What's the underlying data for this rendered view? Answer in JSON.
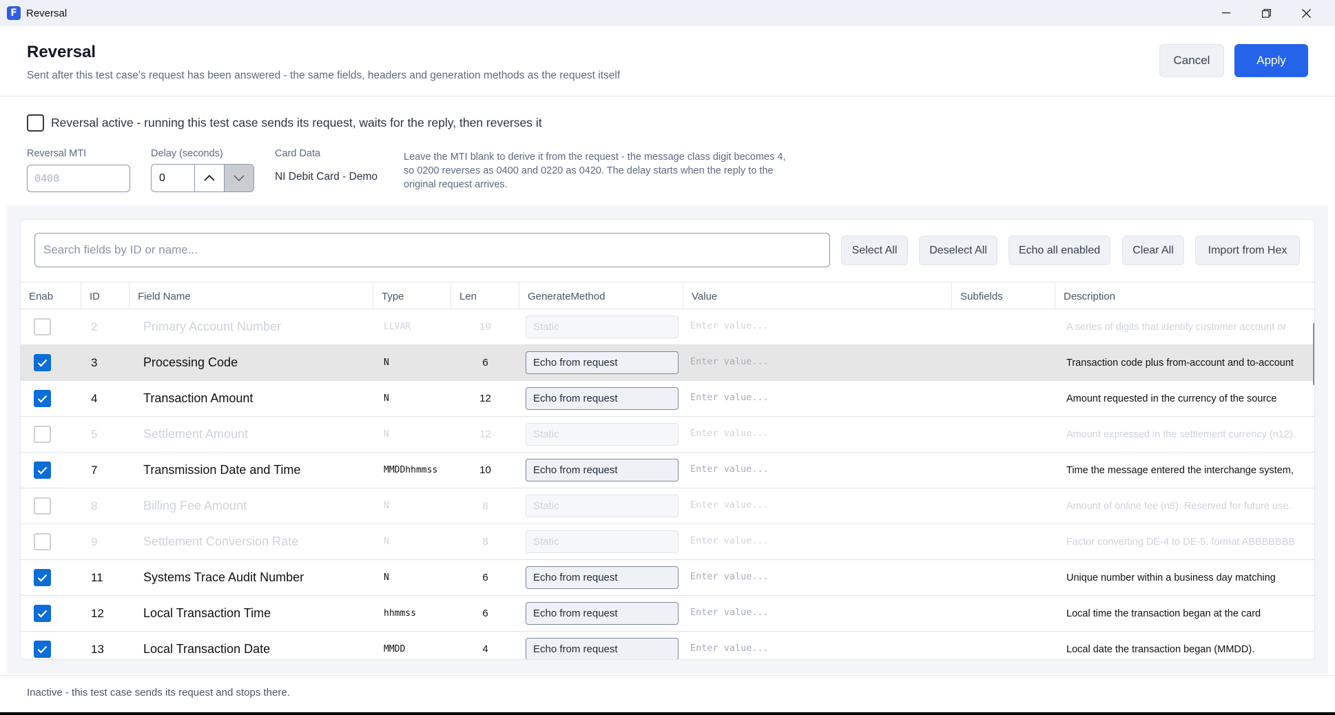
{
  "window": {
    "title": "Reversal",
    "app_icon_letter": "F"
  },
  "header": {
    "title": "Reversal",
    "subtitle": "Sent after this test case's request has been answered - the same fields, headers and generation methods as the request itself",
    "cancel_label": "Cancel",
    "apply_label": "Apply"
  },
  "settings": {
    "active_label": "Reversal active - running this test case sends its request, waits for the reply, then reverses it",
    "active_checked": false,
    "mti_label": "Reversal MTI",
    "mti_placeholder": "0400",
    "delay_label": "Delay (seconds)",
    "delay_value": "0",
    "card_label": "Card Data",
    "card_value": "NI Debit Card - Demo",
    "hint": "Leave the MTI blank to derive it from the request - the message class digit becomes 4, so 0200 reverses as 0400 and 0220 as 0420. The delay starts when the reply to the original request arrives."
  },
  "toolbar": {
    "search_placeholder": "Search fields by ID or name...",
    "select_all": "Select All",
    "deselect_all": "Deselect All",
    "echo_all": "Echo all enabled",
    "clear_all": "Clear All",
    "import_hex": "Import from Hex"
  },
  "table": {
    "columns": [
      "Enab",
      "ID",
      "Field Name",
      "Type",
      "Len",
      "GenerateMethod",
      "Value",
      "Subfields",
      "Description"
    ],
    "value_placeholder": "Enter value...",
    "rows": [
      {
        "enabled": false,
        "selected": false,
        "id": "2",
        "name": "Primary Account Number",
        "type": "LLVAR",
        "len": "19",
        "method": "Static",
        "description": "A series of digits that identify customer account or"
      },
      {
        "enabled": true,
        "selected": true,
        "id": "3",
        "name": "Processing Code",
        "type": "N",
        "len": "6",
        "method": "Echo from request",
        "description": "Transaction code plus from-account and to-account"
      },
      {
        "enabled": true,
        "selected": false,
        "id": "4",
        "name": "Transaction Amount",
        "type": "N",
        "len": "12",
        "method": "Echo from request",
        "description": "Amount requested in the currency of the source"
      },
      {
        "enabled": false,
        "selected": false,
        "id": "5",
        "name": "Settlement Amount",
        "type": "N",
        "len": "12",
        "method": "Static",
        "description": "Amount expressed in the settlement currency (n12)."
      },
      {
        "enabled": true,
        "selected": false,
        "id": "7",
        "name": "Transmission Date and Time",
        "type": "MMDDhhmmss",
        "len": "10",
        "method": "Echo from request",
        "description": "Time the message entered the interchange system,"
      },
      {
        "enabled": false,
        "selected": false,
        "id": "8",
        "name": "Billing Fee Amount",
        "type": "N",
        "len": "8",
        "method": "Static",
        "description": "Amount of online fee (n8). Reserved for future use."
      },
      {
        "enabled": false,
        "selected": false,
        "id": "9",
        "name": "Settlement Conversion Rate",
        "type": "N",
        "len": "8",
        "method": "Static",
        "description": "Factor converting DE-4 to DE-5, format ABBBBBBB"
      },
      {
        "enabled": true,
        "selected": false,
        "id": "11",
        "name": "Systems Trace Audit Number",
        "type": "N",
        "len": "6",
        "method": "Echo from request",
        "description": "Unique number within a business day matching"
      },
      {
        "enabled": true,
        "selected": false,
        "id": "12",
        "name": "Local Transaction Time",
        "type": "hhmmss",
        "len": "6",
        "method": "Echo from request",
        "description": "Local time the transaction began at the card"
      },
      {
        "enabled": true,
        "selected": false,
        "id": "13",
        "name": "Local Transaction Date",
        "type": "MMDD",
        "len": "4",
        "method": "Echo from request",
        "description": "Local date the transaction began (MMDD)."
      }
    ]
  },
  "footer": {
    "status": "Inactive - this test case sends its request and stops there."
  },
  "colors": {
    "accent": "#2563eb",
    "checkbox": "#0a6dd8",
    "selected_row": "#e6e6e6"
  }
}
